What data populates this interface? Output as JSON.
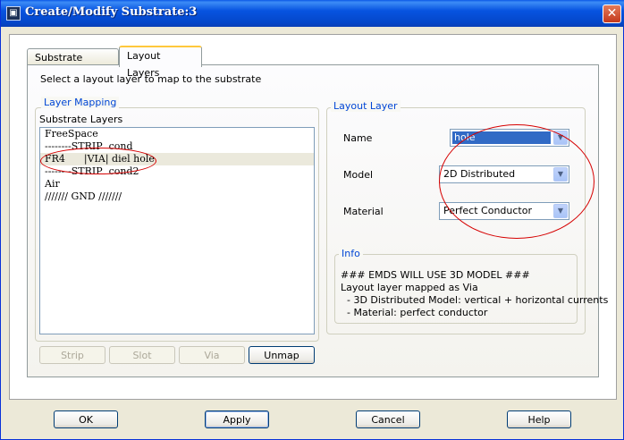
{
  "window": {
    "title": "Create/Modify Substrate:3",
    "close_glyph": "✕"
  },
  "tabs": [
    {
      "label": "Substrate Layers",
      "active": false
    },
    {
      "label": "Layout Layers",
      "active": true
    }
  ],
  "instruction": "Select a layout layer to map to the substrate",
  "layer_mapping": {
    "legend": "Layer Mapping",
    "list_label": "Substrate Layers",
    "items": [
      "FreeSpace",
      "--------STRIP  cond",
      "FR4      |VIA| diel hole",
      "--------STRIP  cond2",
      "Air",
      "/////// GND ///////"
    ],
    "selected_index": 2
  },
  "layer_buttons": {
    "strip": "Strip",
    "slot": "Slot",
    "via": "Via",
    "unmap": "Unmap"
  },
  "layout_layer": {
    "legend": "Layout Layer",
    "name_label": "Name",
    "name_value": "hole",
    "model_label": "Model",
    "model_value": "2D Distributed",
    "material_label": "Material",
    "material_value": "Perfect Conductor"
  },
  "info": {
    "legend": "Info",
    "lines": [
      "### EMDS WILL USE 3D MODEL ###",
      "Layout layer mapped as Via",
      "  - 3D Distributed Model: vertical + horizontal currents",
      "  - Material: perfect conductor"
    ]
  },
  "footer": {
    "ok": "OK",
    "apply": "Apply",
    "cancel": "Cancel",
    "help": "Help"
  },
  "colors": {
    "titlebar": "#0753e0",
    "accent_legend": "#0046d5",
    "annotation": "#d60000",
    "selection": "#316ac5"
  },
  "icons": {
    "app": "app-icon",
    "close": "close-icon",
    "dropdown": "chevron-down-icon"
  }
}
